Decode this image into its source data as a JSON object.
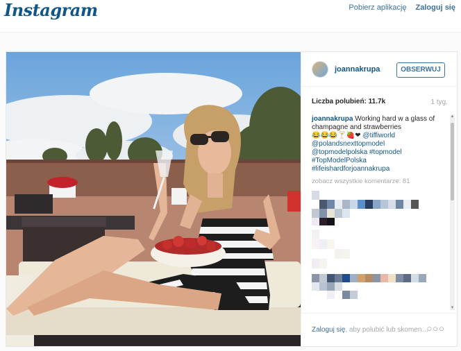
{
  "header": {
    "logo": "Instagram",
    "get_app": "Pobierz aplikację",
    "login": "Zaloguj się"
  },
  "post": {
    "username": "joannakrupa",
    "follow_label": "OBSERWUJ",
    "likes": "Liczba polubień: 11.7k",
    "time": "1 tyg.",
    "caption": {
      "username": "joannakrupa",
      "text": " Working hard w a glass of champagne and strawberries",
      "emoji": "😂😂😂🍸🍓❤",
      "tag1": "@tiffiworld",
      "tag2": "@polandsnexttopmodel",
      "tag3": "@topmodelpolska",
      "tag4": "#topmodel",
      "tag5": "#TopModelPolska",
      "tag6": "#lifeishardforjoannakrupa"
    },
    "view_all": "zobacz wszystkie komentarze: 81",
    "footer_login": "Zaloguj się",
    "footer_text": ", aby polubić lub skomen…",
    "more": "○○○"
  },
  "colors": {
    "brand": "#125688",
    "link": "#3f729b",
    "muted": "#a5a7aa"
  }
}
